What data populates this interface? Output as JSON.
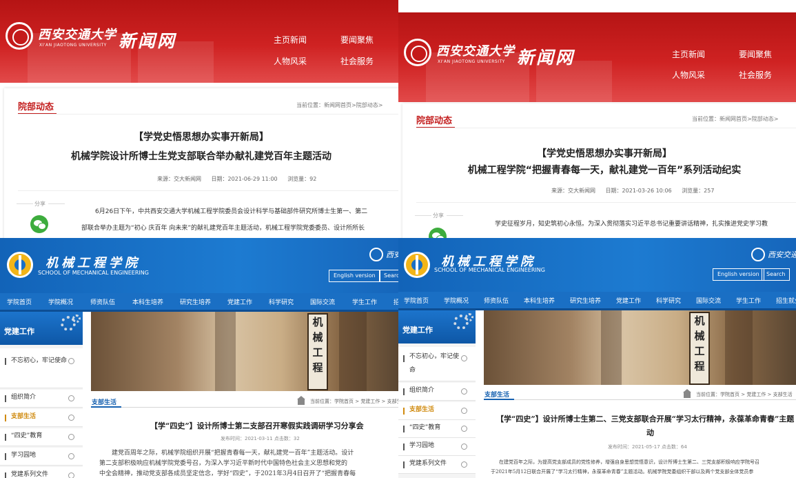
{
  "news_site": {
    "university_name": "西安交通大学",
    "university_en": "XI'AN JIAOTONG UNIVERSITY",
    "site_name": "新闻网",
    "nav": [
      "主页新闻",
      "要闻聚焦",
      "人物风采",
      "社会服务"
    ],
    "section_title": "院部动态",
    "share_label": "分享",
    "share_icon": "wechat-icon",
    "accent_color": "#c31e1e"
  },
  "article_a": {
    "breadcrumb": "当前位置：新闻网首页>院部动态>",
    "headline_1": "【学党史悟思想办实事开新局】",
    "headline_2": "机械学院设计所博士生党支部联合举办献礼建党百年主题活动",
    "source": "来源：交大新闻网",
    "date": "日期：2021-06-29 11:00",
    "views": "浏览量：92",
    "body_1": "6月26日下午，中共西安交通大学机械工程学院委员会设计科学与基础部件研究所博士生第一、第二",
    "body_2": "部联合举办主题为“初心 庆百年 向未来”的献礼建党百年主题活动，机械工程学院党委委员、设计所所长"
  },
  "article_b": {
    "breadcrumb": "当前位置：新闻网首页>院部动态>",
    "headline_1": "【学党史悟思想办实事开新局】",
    "headline_2": "机械工程学院“把握青春每一天，献礼建党一百年”系列活动纪实",
    "source": "来源：交大新闻网",
    "date": "日期：2021-03-26 10:06",
    "views": "浏览量：257",
    "body_1": "学史征程岁月，知史筑初心永恒。为深入贯彻落实习近平总书记重要讲话精神，扎实推进党史学习教"
  },
  "school_site": {
    "name": "机械工程学院",
    "name_en": "SCHOOL OF MECHANICAL ENGINEERING",
    "university_name": "西安交通大学",
    "english_btn": "English version",
    "search_btn": "Search",
    "nav": [
      "学院首页",
      "学院概况",
      "师资队伍",
      "本科生培养",
      "研究生培养",
      "党建工作",
      "科学研究",
      "国际交流",
      "学生工作",
      "招生就业"
    ],
    "sidebar_title": "党建工作",
    "sidebar_items": [
      "不忘初心，牢记使命",
      "组织简介",
      "支部生活",
      "“四史”教育",
      "学习园地",
      "党建系列文件"
    ],
    "sidebar_active": "支部生活",
    "banner_plaque": [
      "机",
      "械",
      "工",
      "程"
    ],
    "section_title": "支部生活",
    "accent_color": "#1560b0"
  },
  "article_c": {
    "breadcrumb": "当前位置：学院首页 > 党建工作 > 支部生活",
    "title": "【学“四史”】设计所博士第二支部召开寒假实践调研学习分享会",
    "meta": "发布时间：2021-03-11 点击数：32",
    "body_1": "建党百周年之际，机械学院组织开展“把握青春每一天，献礼建党一百年”主题活动。设计",
    "body_2": "第二支部积极响应机械学院党委号召，为深入学习近平新时代中国特色社会主义思想和党的",
    "body_3": "中全会精神，推动党支部各成员坚定信念，学好“四史”，于2021年3月4日召开了“把握青春每"
  },
  "article_d": {
    "breadcrumb": "当前位置：学院首页 > 党建工作 > 支部生活",
    "title_1": "【学“四史”】设计所博士生第二、三党支部联合开展“学习太行精神，永葆革命青春”主题",
    "title_2": "动",
    "meta": "发布时间：2021-05-17 点击数：64",
    "body_1": "在建党百年之际，为提高党支部成员的党性修养，增强自身思想觉悟意识，设计所博士生第二、三党支部积极响应学院号召",
    "body_2": "于2021年5月12日联合开展了“学习太行精神，永葆革命青春”主题活动。机械学院党委组织干部以及两个党支部全体党员参"
  }
}
